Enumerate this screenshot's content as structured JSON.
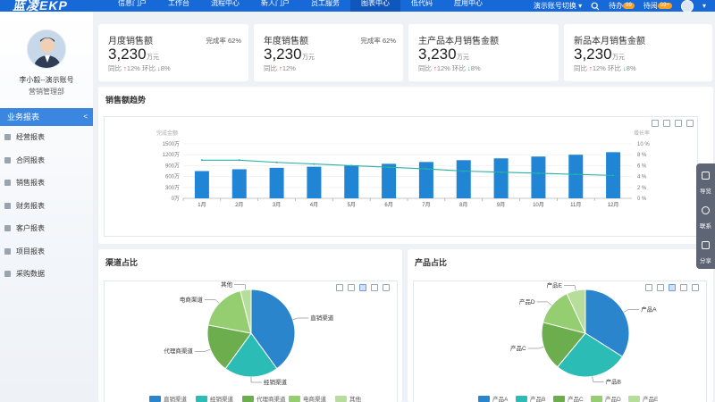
{
  "app": {
    "logo": "蓝凌EKP"
  },
  "nav": {
    "items": [
      "信息门户",
      "工作台",
      "流程中心",
      "新人门户",
      "员工服务",
      "图表中心",
      "低代码",
      "应用中心"
    ],
    "active_index": 5,
    "account_switch": "演示账号切换",
    "todo": {
      "label": "待办",
      "count": "99"
    },
    "to_read": {
      "label": "待阅",
      "count": "99+"
    }
  },
  "profile": {
    "name": "李小毅--演示账号",
    "dept": "营销管理部"
  },
  "sidebar": {
    "head": "业务报表",
    "items": [
      "经营报表",
      "合同报表",
      "销售报表",
      "财务报表",
      "客户报表",
      "项目报表",
      "采购数据"
    ]
  },
  "kpis": [
    {
      "title": "月度销售额",
      "rate": "完成率 62%",
      "value": "3,230",
      "unit": "万元",
      "yoy_label": "同比",
      "yoy": "12%",
      "mom_label": "环比",
      "mom": "8%"
    },
    {
      "title": "年度销售额",
      "rate": "完成率 62%",
      "value": "3,230",
      "unit": "万元",
      "yoy_label": "同比",
      "yoy": "12%",
      "mom_label": "",
      "mom": ""
    },
    {
      "title": "主产品本月销售金额",
      "rate": "",
      "value": "3,230",
      "unit": "万元",
      "yoy_label": "同比",
      "yoy": "12%",
      "mom_label": "环比",
      "mom": "8%"
    },
    {
      "title": "新品本月销售金额",
      "rate": "",
      "value": "3,230",
      "unit": "万元",
      "yoy_label": "同比",
      "yoy": "12%",
      "mom_label": "环比",
      "mom": "8%"
    }
  ],
  "panels": {
    "trend": "销售额趋势",
    "channel": "渠道占比",
    "product": "产品占比"
  },
  "float_tools": [
    "导览",
    "联系",
    "分享"
  ],
  "colors": {
    "primary": "#1769d8",
    "bar": "#1f85d4",
    "line": "#26b3a6",
    "up": "#e23a3a",
    "down": "#25a856"
  },
  "chart_data": [
    {
      "type": "bar",
      "title": "销售额趋势",
      "categories": [
        "1月",
        "2月",
        "3月",
        "4月",
        "5月",
        "6月",
        "7月",
        "8月",
        "9月",
        "10月",
        "11月",
        "12月"
      ],
      "series": [
        {
          "name": "完成金额",
          "type": "bar",
          "values": [
            750,
            800,
            840,
            870,
            910,
            950,
            1000,
            1050,
            1100,
            1150,
            1200,
            1270
          ]
        },
        {
          "name": "增长率",
          "type": "line",
          "axis": "right",
          "values": [
            7.0,
            7.0,
            6.6,
            6.3,
            6.0,
            5.7,
            5.4,
            5.0,
            4.8,
            4.6,
            4.4,
            4.2
          ]
        }
      ],
      "y_ticks": [
        "0万",
        "300万",
        "600万",
        "900万",
        "1200万",
        "1500万"
      ],
      "y2_ticks": [
        "0 %",
        "2 %",
        "4 %",
        "6 %",
        "8 %",
        "10 %"
      ],
      "ylim": [
        0,
        1500
      ],
      "y2lim": [
        0,
        10
      ],
      "ylabel": "完成金额",
      "y2label": "增长率"
    },
    {
      "type": "pie",
      "title": "渠道占比",
      "labels": [
        "直销渠道",
        "经销渠道",
        "代理商渠道",
        "电商渠道",
        "其他"
      ],
      "values": [
        40,
        20,
        18,
        18,
        4
      ],
      "colors": [
        "#2a85cc",
        "#2bbdb5",
        "#6cad4e",
        "#95cd71",
        "#b6dd9a"
      ],
      "legend": "bottom"
    },
    {
      "type": "pie",
      "title": "产品占比",
      "labels": [
        "产品A",
        "产品B",
        "产品C",
        "产品D",
        "产品E"
      ],
      "values": [
        34,
        27,
        18,
        14,
        7
      ],
      "colors": [
        "#2a85cc",
        "#2bbdb5",
        "#6cad4e",
        "#95cd71",
        "#b6dd9a"
      ],
      "legend": "bottom"
    }
  ]
}
